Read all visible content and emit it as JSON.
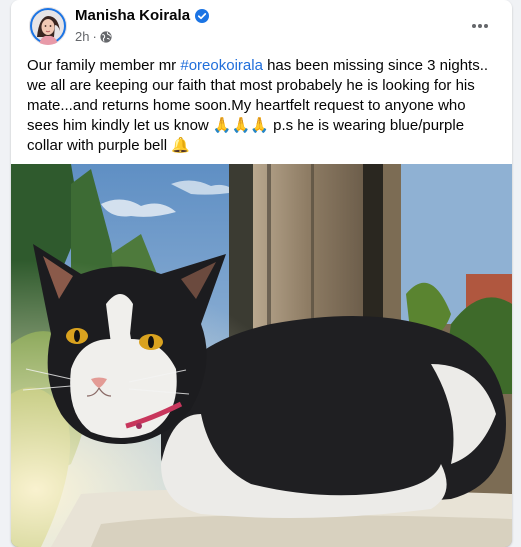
{
  "post": {
    "author": "Manisha Koirala",
    "verified": true,
    "timestamp": "2h",
    "separator": "·",
    "privacy_icon": "globe-icon",
    "more_icon": "more-horizontal-icon",
    "text_before_hashtag": "Our family member mr ",
    "hashtag": "#oreokoirala",
    "text_after_hashtag": " has been missing since 3 nights.. we all are keeping our faith that most probabely he is looking for his mate...and returns home soon.My heartfelt request to anyone who sees him kindly let us know ",
    "prayer_emojis": "🙏🙏🙏",
    "text_after_emojis": " p.s he is wearing blue/purple collar with purple bell ",
    "bell_emoji": "🔔",
    "photo_subject": "black-and-white-cat"
  },
  "colors": {
    "background": "#f0f2f5",
    "card": "#ffffff",
    "hashtag": "#216fdb",
    "verified": "#1b74e4",
    "secondary_text": "#65676b"
  }
}
